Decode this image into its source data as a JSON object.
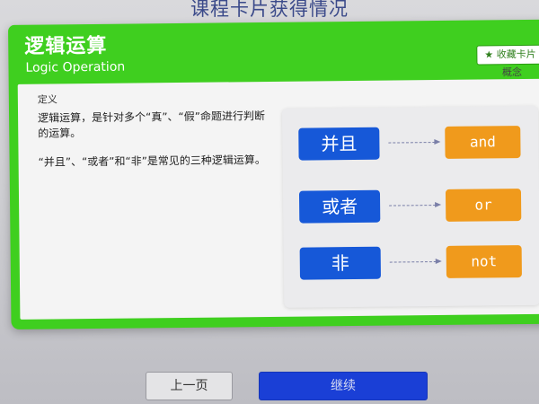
{
  "background": {
    "title": "课程卡片获得情况"
  },
  "card": {
    "title": "逻辑运算",
    "subtitle": "Logic Operation",
    "favorite_button": "★ 收藏卡片",
    "tag": "概念",
    "definition_label": "定义",
    "definition_p1": "逻辑运算，是针对多个“真”、“假”命题进行判断的运算。",
    "definition_p2": "“并且”、“或者”和“非”是常见的三种逻辑运算。",
    "operations": [
      {
        "zh": "并且",
        "en": "and"
      },
      {
        "zh": "或者",
        "en": "or"
      },
      {
        "zh": "非",
        "en": "not"
      }
    ]
  },
  "footer": {
    "prev_label": "上一页",
    "next_label": "继续"
  },
  "colors": {
    "card_green": "#3fcf1f",
    "operation_blue": "#1658d8",
    "keyword_orange": "#f09a1c",
    "continue_blue": "#1a3fd6"
  }
}
